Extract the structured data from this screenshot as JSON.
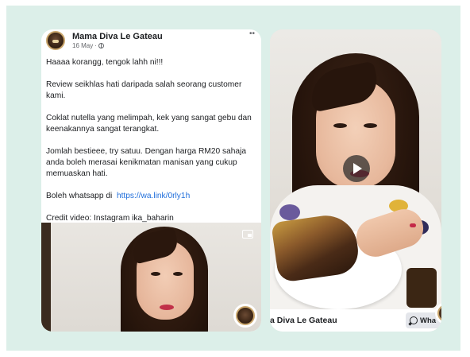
{
  "post": {
    "page_name": "Mama Diva Le Gateau",
    "date": "16 May",
    "date_separator": "·",
    "more_icon": "more-dots-icon",
    "paragraphs": [
      "Haaaa korangg, tengok lahh ni!!!",
      "Review seikhlas hati daripada salah seorang customer kami.",
      "Coklat nutella yang melimpah, kek yang sangat gebu dan keenakannya sangat terangkat.",
      "Jomlah bestieee, try satuu. Dengan harga RM20 sahaja anda boleh merasai kenikmatan manisan yang cukup memuaskan hati."
    ],
    "whatsapp_prefix": "Boleh whatsapp di",
    "whatsapp_link": "https://wa.link/0rly1h",
    "credit": "Credit video: Instagram ika_baharin"
  },
  "video_right": {
    "page_name_truncated": "a Diva Le Gateau",
    "cta_label": "Wha",
    "cta_icon": "whatsapp-icon"
  },
  "colors": {
    "background": "#dcefe9",
    "link": "#216fdb",
    "text": "#1c1e21",
    "meta": "#65676b"
  }
}
